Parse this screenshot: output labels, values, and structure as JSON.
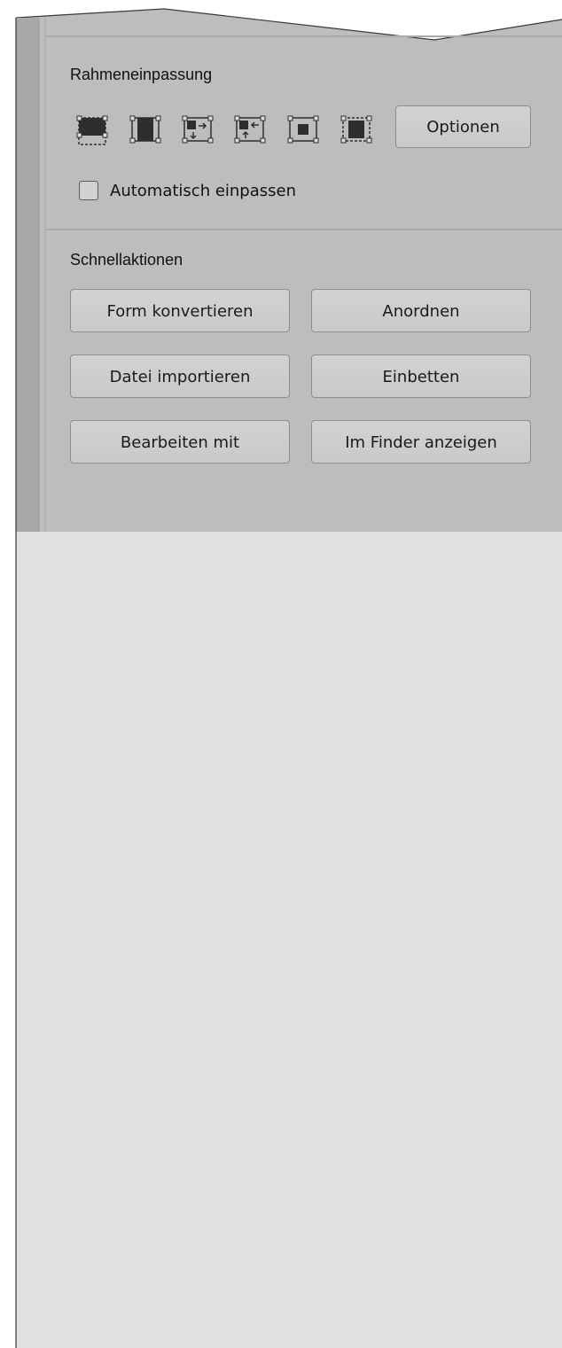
{
  "frame_fitting": {
    "title": "Rahmeneinpassung",
    "icons": [
      "fill-frame-proportionally-icon",
      "fit-content-proportionally-icon",
      "fit-frame-to-content-icon",
      "fit-content-to-frame-icon",
      "center-content-icon",
      "content-aware-fit-icon"
    ],
    "options_label": "Optionen",
    "auto_fit_label": "Automatisch einpassen",
    "auto_fit_checked": false
  },
  "quick_actions": {
    "title": "Schnellaktionen",
    "buttons": [
      "Form konvertieren",
      "Anordnen",
      "Datei importieren",
      "Einbetten",
      "Bearbeiten mit",
      "Im Finder anzeigen"
    ]
  },
  "colors": {
    "panel_bg": "#bdbdbd",
    "lower_bg": "#e0e0e0",
    "left_strip": "#a8a8a8",
    "button_bg": "#cccccc"
  }
}
